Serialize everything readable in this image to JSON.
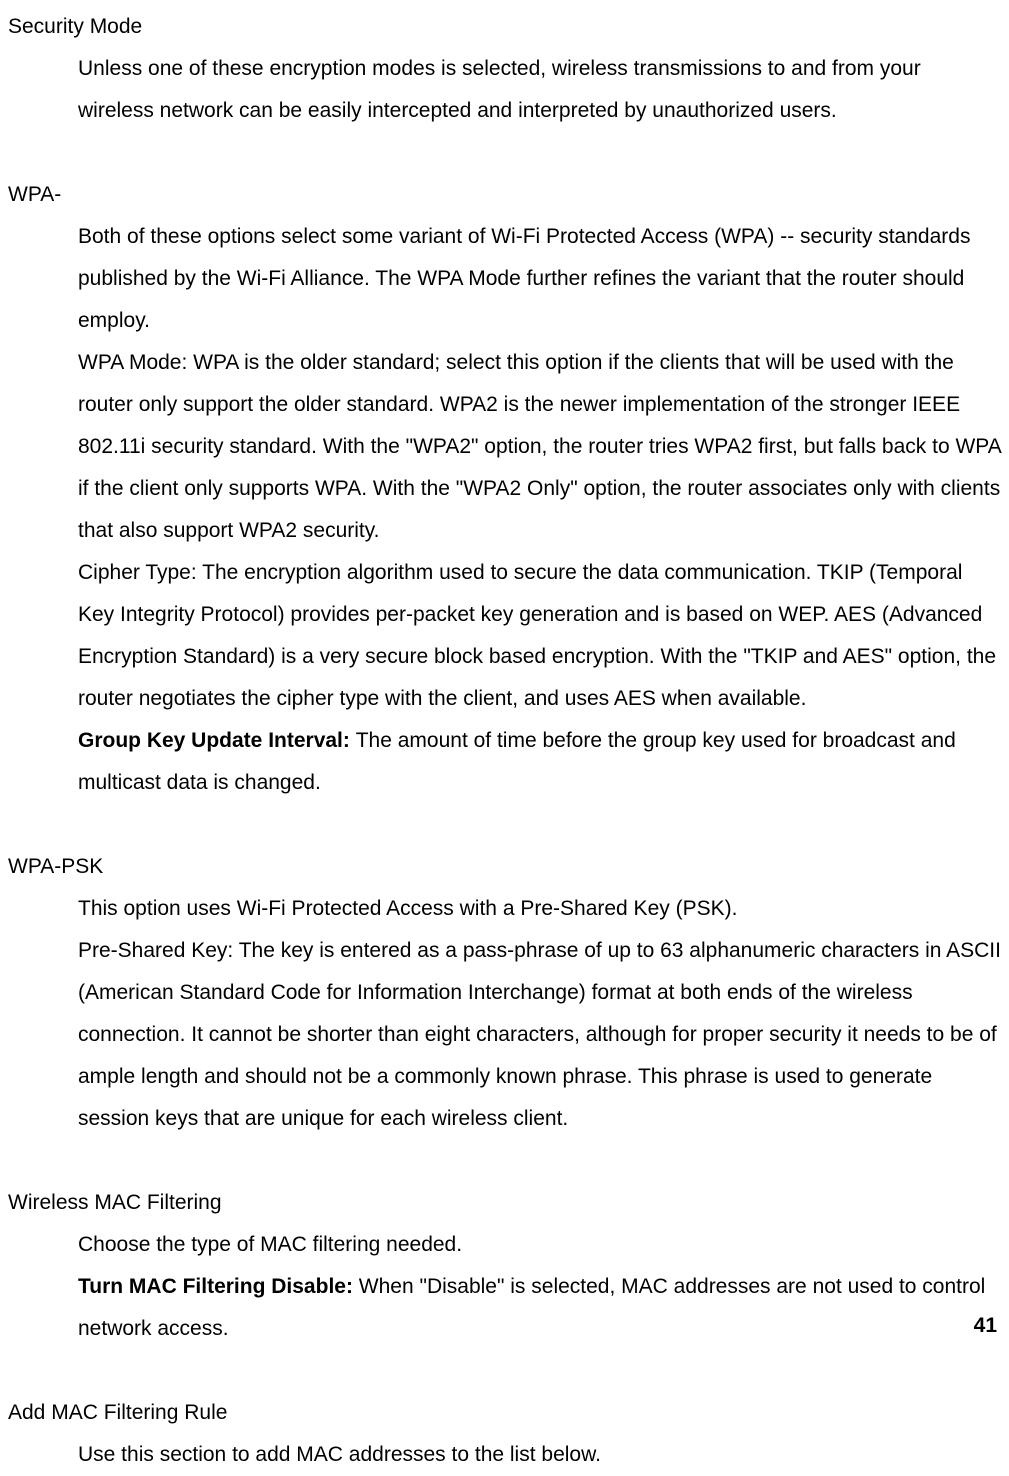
{
  "sections": {
    "security_mode": {
      "heading": "Security Mode",
      "para1": "Unless one of these encryption modes is selected, wireless transmissions to and from your wireless network can be easily intercepted and interpreted by unauthorized users."
    },
    "wpa": {
      "heading": "WPA-",
      "para1": "Both of these options select some variant of Wi-Fi Protected Access (WPA) -- security standards published by the Wi-Fi Alliance. The WPA Mode further refines the variant that the router should employ.",
      "para2": "WPA Mode: WPA is the older standard; select this option if the clients that will be used with the router only support the older standard. WPA2 is the newer implementation of the stronger IEEE 802.11i security standard. With the \"WPA2\" option, the router tries WPA2 first, but falls back to WPA if the client only supports WPA. With the \"WPA2 Only\" option, the router associates only with clients that also support WPA2 security.",
      "para3": "Cipher Type: The encryption algorithm used to secure the data communication. TKIP (Temporal Key Integrity Protocol) provides per-packet key generation and is based on WEP. AES (Advanced Encryption Standard) is a very secure block based encryption. With the \"TKIP and AES\" option, the router negotiates the cipher type with the client, and uses AES when available.",
      "para4_bold": "Group Key Update Interval: ",
      "para4_rest": "The amount of time before the group key used for broadcast and multicast data is changed."
    },
    "wpa_psk": {
      "heading": "WPA-PSK",
      "para1": "This option uses Wi-Fi Protected Access with a Pre-Shared Key (PSK).",
      "para2": "Pre-Shared Key: The key is entered as a pass-phrase of up to 63 alphanumeric characters in ASCII (American Standard Code for Information Interchange) format at both ends of the wireless connection. It cannot be shorter than eight characters, although for proper security it needs to be of ample length and should not be a commonly known phrase. This phrase is used to generate session keys that are unique for each wireless client."
    },
    "mac_filtering": {
      "heading": "Wireless MAC Filtering",
      "para1": "Choose the type of MAC filtering needed.",
      "para2_bold": "Turn MAC Filtering Disable: ",
      "para2_rest": "When \"Disable\" is selected, MAC addresses are not used to control network access."
    },
    "add_mac_rule": {
      "heading": "Add MAC Filtering Rule",
      "para1": "Use this section to add MAC addresses to the list below."
    }
  },
  "page_number": "41"
}
